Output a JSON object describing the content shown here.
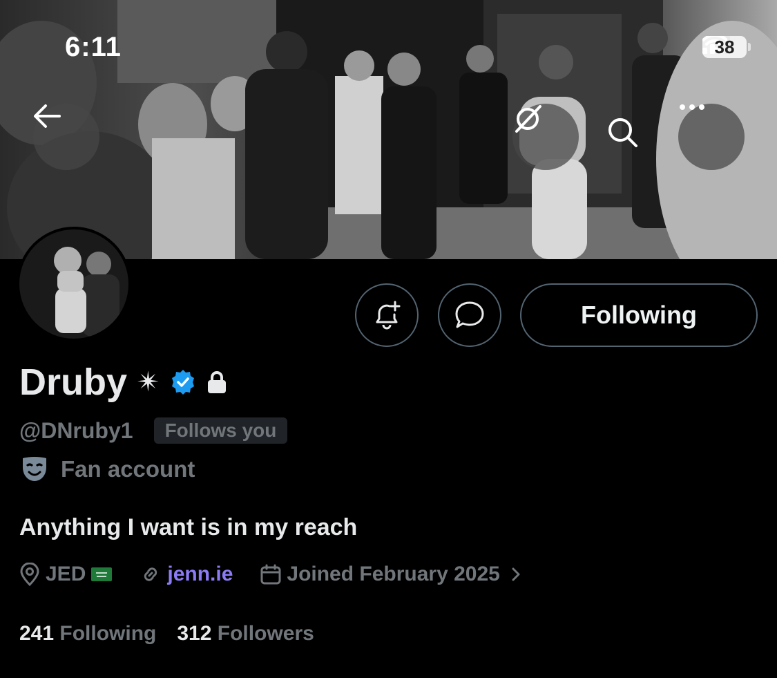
{
  "status_bar": {
    "time": "6:11",
    "battery": "38"
  },
  "profile": {
    "display_name": "Druby",
    "name_emoji": "✴",
    "handle": "@DNruby1",
    "follows_you": "Follows you",
    "category": "Fan account",
    "bio": "Anything I want is in my reach",
    "location": "JED",
    "link": "jenn.ie",
    "joined": "Joined February 2025",
    "following_count": "241",
    "following_label": "Following",
    "followers_count": "312",
    "followers_label": "Followers"
  },
  "actions": {
    "following_button": "Following"
  },
  "icons": {
    "back": "arrow-left-icon",
    "grok": "grok-icon",
    "search": "search-icon",
    "more": "more-icon",
    "notify": "bell-plus-icon",
    "message": "chat-bubble-icon",
    "verified": "verified-badge-icon",
    "lock": "lock-icon",
    "category": "theater-mask-icon",
    "location": "location-pin-icon",
    "link": "link-icon",
    "calendar": "calendar-icon",
    "flag": "saudi-flag-icon"
  },
  "colors": {
    "verified": "#1d9bf0",
    "link": "#8b7cf6",
    "muted": "#71767b",
    "border": "#536471",
    "flag": "#1f7a3a"
  }
}
